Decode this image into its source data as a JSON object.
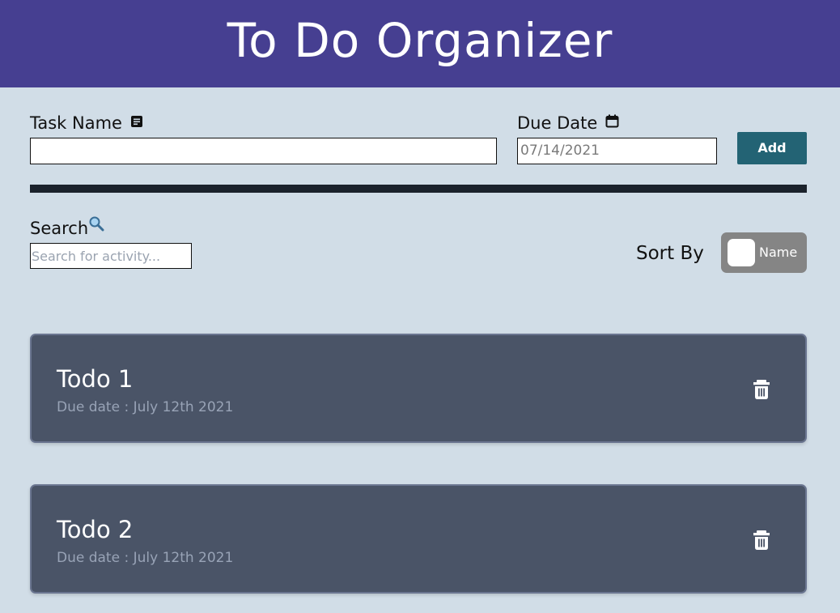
{
  "header": {
    "title": "To Do Organizer",
    "color": "#463f91"
  },
  "form": {
    "task_name_label": "Task Name",
    "task_name_icon": "notes-icon",
    "task_name_value": "",
    "due_date_label": "Due Date",
    "due_date_icon": "calendar-icon",
    "due_date_value": "07/14/2021",
    "add_label": "Add",
    "add_color": "#236374"
  },
  "search": {
    "label": "Search",
    "icon": "magnifier-icon",
    "placeholder": "Search for activity..."
  },
  "sort": {
    "label": "Sort By",
    "toggle_text": "Name"
  },
  "todos": [
    {
      "title": "Todo 1",
      "due": "Due date : July 12th 2021",
      "icon": "trash-icon"
    },
    {
      "title": "Todo 2",
      "due": "Due date : July 12th 2021",
      "icon": "trash-icon"
    }
  ]
}
